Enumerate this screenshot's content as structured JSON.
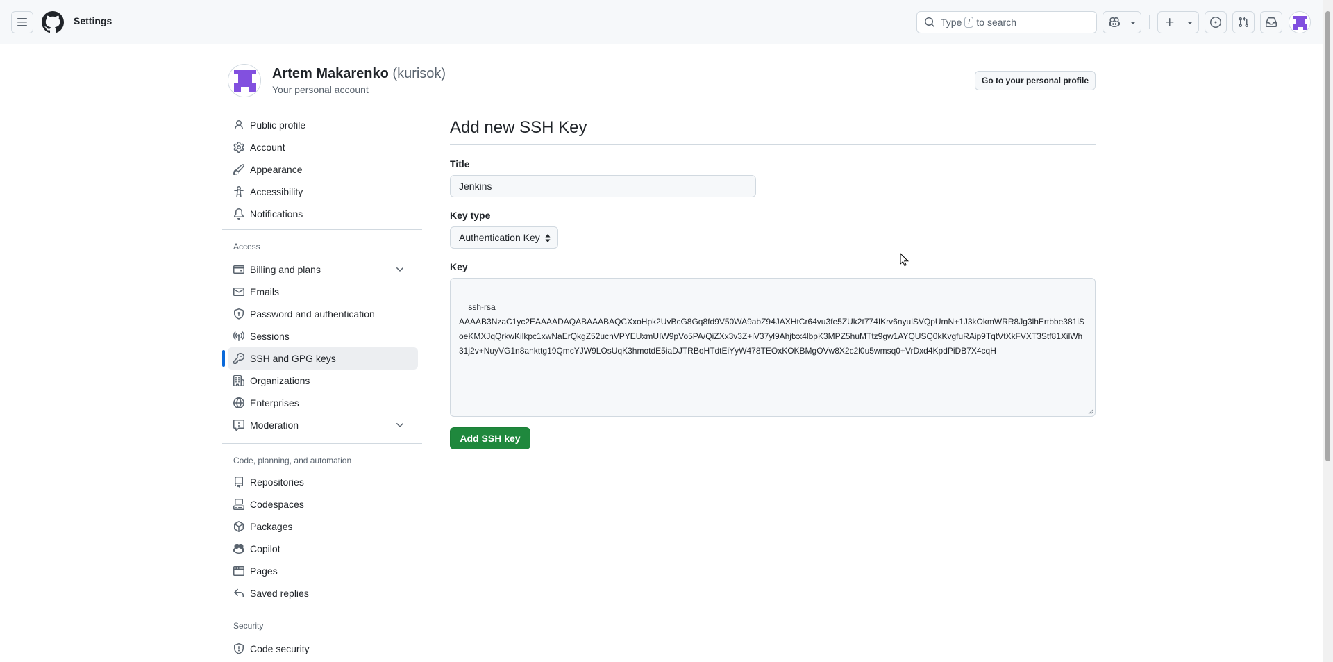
{
  "header": {
    "title": "Settings",
    "search_prefix": "Type",
    "search_key": "/",
    "search_suffix": "to search"
  },
  "account": {
    "name": "Artem Makarenko",
    "login": "(kurisok)",
    "subtitle": "Your personal account",
    "profile_button": "Go to your personal profile"
  },
  "sidebar": {
    "items": [
      {
        "label": "Public profile",
        "icon": "person-icon"
      },
      {
        "label": "Account",
        "icon": "gear-icon"
      },
      {
        "label": "Appearance",
        "icon": "paintbrush-icon"
      },
      {
        "label": "Accessibility",
        "icon": "accessibility-icon"
      },
      {
        "label": "Notifications",
        "icon": "bell-icon"
      }
    ],
    "access_label": "Access",
    "access_items": [
      {
        "label": "Billing and plans",
        "icon": "credit-card-icon"
      },
      {
        "label": "Emails",
        "icon": "mail-icon"
      },
      {
        "label": "Password and authentication",
        "icon": "shield-lock-icon"
      },
      {
        "label": "Sessions",
        "icon": "broadcast-icon"
      },
      {
        "label": "SSH and GPG keys",
        "icon": "key-icon"
      },
      {
        "label": "Organizations",
        "icon": "organization-icon"
      },
      {
        "label": "Enterprises",
        "icon": "globe-icon"
      },
      {
        "label": "Moderation",
        "icon": "report-icon"
      }
    ],
    "code_label": "Code, planning, and automation",
    "code_items": [
      {
        "label": "Repositories",
        "icon": "repo-icon"
      },
      {
        "label": "Codespaces",
        "icon": "codespaces-icon"
      },
      {
        "label": "Packages",
        "icon": "package-icon"
      },
      {
        "label": "Copilot",
        "icon": "copilot-icon"
      },
      {
        "label": "Pages",
        "icon": "browser-icon"
      },
      {
        "label": "Saved replies",
        "icon": "reply-icon"
      }
    ],
    "security_label": "Security",
    "security_items": [
      {
        "label": "Code security",
        "icon": "shield-icon"
      }
    ]
  },
  "form": {
    "heading": "Add new SSH Key",
    "title_label": "Title",
    "title_value": "Jenkins",
    "key_type_label": "Key type",
    "key_type_value": "Authentication Key",
    "key_label": "Key",
    "key_value": "ssh-rsa\nAAAAB3NzaC1yc2EAAAADAQABAAABAQCXxoHpk2UvBcG8Gq8fd9V50WA9abZ94JAXHtCr64vu3fe5ZUk2t774IKrv6nyulSVQpUmN+1J3kOkmWRR8Jg3lhErtbbe381iSoeKMXJqQrkwKilkpc1xwNaErQkgZ52ucnVPYEUxmUIW9pVo5PA/QiZXx3v3Z+iV37yl9Ahjtxx4lbpK3MPZ5huMTtz9gw1AYQUSQ0kKvgfuRAip9TqtVtXkFVXT3Stf81XilWh31j2v+NuyVG1n8ankttg19QmcYJW9LOsUqK3hmotdE5iaDJTRBoHTdtEiYyW478TEOxKOKBMgOVw8X2c2l0u5wmsq0+VrDxd4KpdPiDB7X4cqH",
    "submit_label": "Add SSH key"
  },
  "colors": {
    "accent": "#0969da",
    "primary_button": "#1f883d",
    "avatar": "#8250df"
  }
}
